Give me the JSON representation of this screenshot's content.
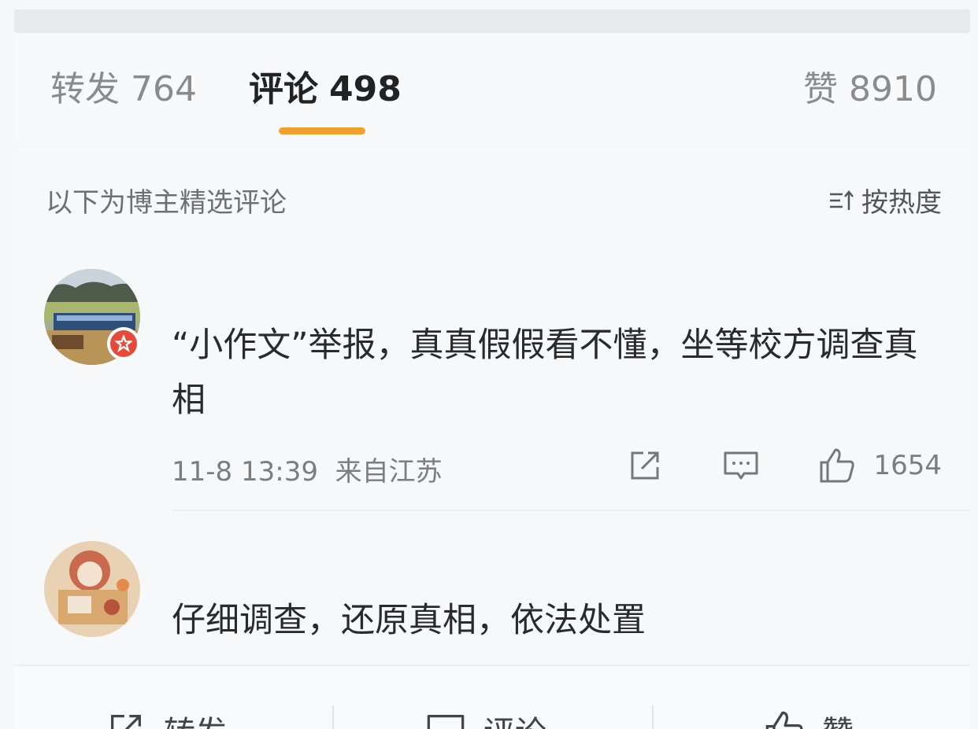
{
  "tabs": {
    "repost": {
      "label": "转发",
      "count": "764"
    },
    "comment": {
      "label": "评论",
      "count": "498"
    },
    "like": {
      "label": "赞",
      "count": "8910"
    }
  },
  "filter": {
    "note": "以下为博主精选评论",
    "sort_label": "按热度",
    "sort_icon": "sort-icon"
  },
  "comments": [
    {
      "text": "“小作文”举报，真真假假看不懂，坐等校方调查真相",
      "time": "11-8 13:39",
      "location": "来自江苏",
      "likes": "1654"
    },
    {
      "text": "仔细调查，还原真相，依法处置"
    }
  ],
  "bottom_bar": {
    "repost_label": "转发",
    "comment_label": "评论",
    "like_label": "赞"
  },
  "colors": {
    "accent": "#f0a02d",
    "badge": "#e64a3b"
  }
}
